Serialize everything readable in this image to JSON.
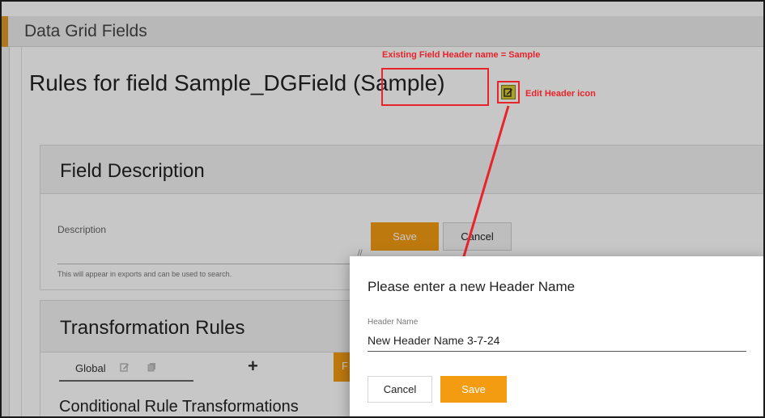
{
  "window": {
    "title": "Data Grid Fields"
  },
  "page": {
    "heading": "Rules for field Sample_DGField (Sample)"
  },
  "field_description": {
    "title": "Field Description",
    "description_label": "Description",
    "hint": "This will appear in exports and can be used to search.",
    "save_label": "Save",
    "cancel_label": "Cancel"
  },
  "transformation_rules": {
    "title": "Transformation Rules",
    "tab_global": "Global",
    "add_symbol": "+",
    "stub_letter": "F",
    "conditional_title": "Conditional Rule Transformations"
  },
  "annotations": {
    "existing_header": "Existing Field Header name = Sample",
    "edit_header_icon": "Edit Header icon",
    "color": "#e8232a"
  },
  "modal": {
    "title": "Please enter a new Header Name",
    "field_label": "Header Name",
    "field_value": "New Header Name 3-7-24",
    "cancel_label": "Cancel",
    "save_label": "Save"
  },
  "colors": {
    "accent": "#f39c12",
    "edit_icon": "#d6cc33"
  },
  "icons": [
    "edit-header-icon",
    "tab-edit-icon",
    "tab-copy-icon",
    "add-icon",
    "resize-grip-icon"
  ]
}
